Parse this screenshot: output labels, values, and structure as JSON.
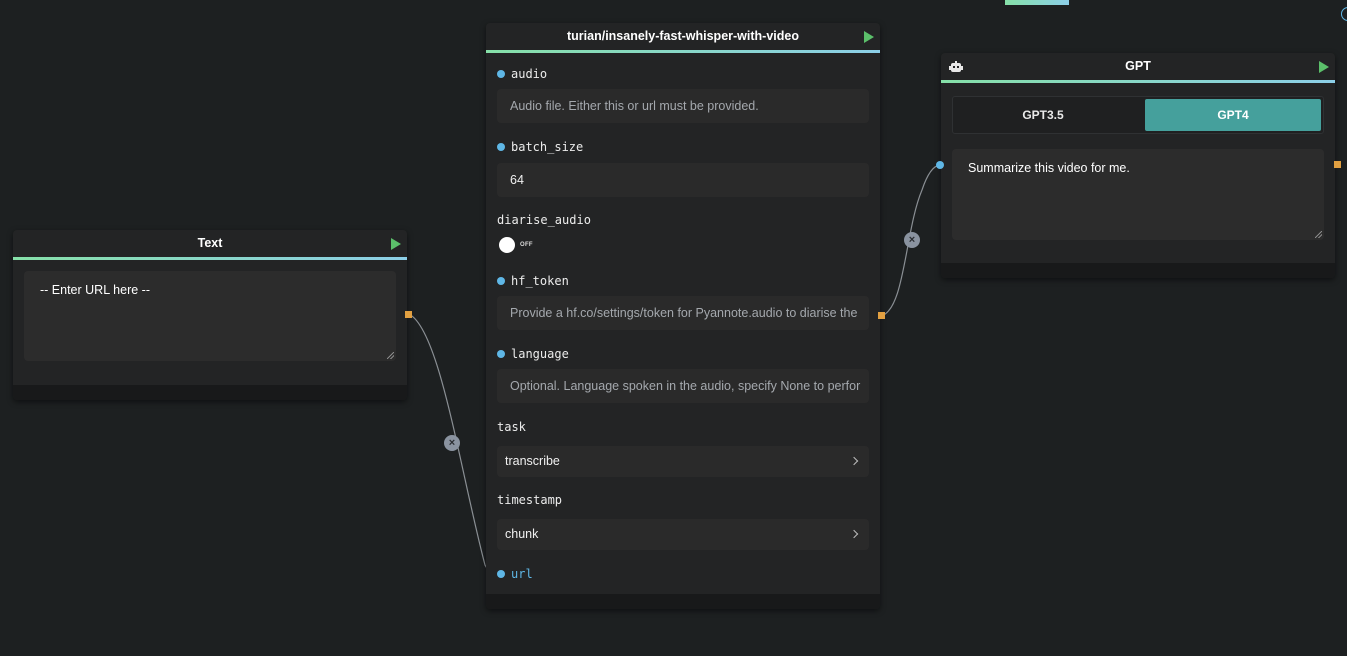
{
  "colors": {
    "background": "#1d2021",
    "node": "#232425",
    "accent_green": "#86e0a8",
    "accent_blue": "#8ccfe8",
    "port_in": "#5fb7e6",
    "port_out": "#e2a041",
    "active_tab": "#45a09c",
    "play": "#5bbf6a"
  },
  "text_node": {
    "title": "Text",
    "content": "-- Enter URL here --"
  },
  "whisper_node": {
    "title": "turian/insanely-fast-whisper-with-video",
    "fields": {
      "audio": {
        "label": "audio",
        "placeholder": "Audio file. Either this or url must be provided."
      },
      "batch_size": {
        "label": "batch_size",
        "value": "64"
      },
      "diarise_audio": {
        "label": "diarise_audio",
        "toggle_text": "OFF",
        "value": "off"
      },
      "hf_token": {
        "label": "hf_token",
        "placeholder": "Provide a hf.co/settings/token for Pyannote.audio to diarise the"
      },
      "language": {
        "label": "language",
        "placeholder": "Optional. Language spoken in the audio, specify None to perfor"
      },
      "task": {
        "label": "task",
        "value": "transcribe"
      },
      "timestamp": {
        "label": "timestamp",
        "value": "chunk"
      },
      "url": {
        "label": "url"
      }
    }
  },
  "gpt_node": {
    "title": "GPT",
    "icon": "robot-icon",
    "options": [
      "GPT3.5",
      "GPT4"
    ],
    "selected": "GPT4",
    "prompt": "Summarize this video for me."
  }
}
